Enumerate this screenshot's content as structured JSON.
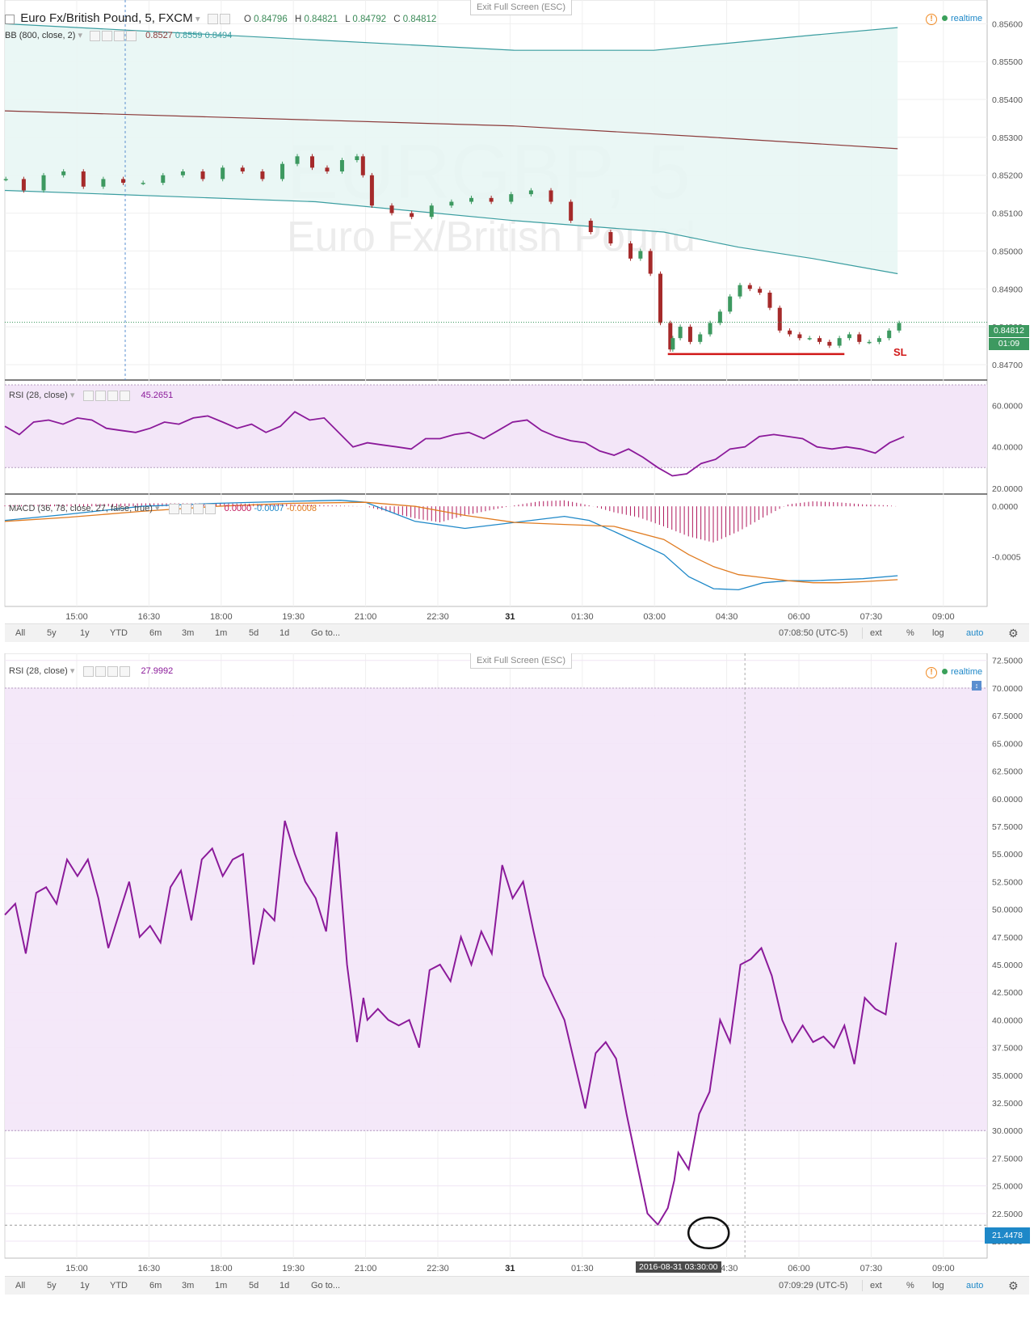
{
  "top": {
    "exit_label": "Exit Full Screen (ESC)",
    "symbol_title": "Euro Fx/British Pound, 5, FXCM",
    "ohlc": {
      "o_label": "O",
      "o": "0.84796",
      "h_label": "H",
      "h": "0.84821",
      "l_label": "L",
      "l": "0.84792",
      "c_label": "C",
      "c": "0.84812"
    },
    "bb_label": "BB (800, close, 2)",
    "bb_values": [
      "0.8527",
      "0.8559",
      "0.8494"
    ],
    "realtime_label": "realtime",
    "watermark_main": "EURGBP, 5",
    "watermark_sub": "Euro Fx/British Pound",
    "last_price": "0.84812",
    "countdown": "01:09",
    "sl_label": "SL",
    "rsi_label": "RSI (28, close)",
    "rsi_value": "45.2651",
    "macd_label": "MACD (36, 78, close, 27, false, true)",
    "macd_values": [
      "0.0000",
      "-0.0007",
      "-0.0008"
    ],
    "time_display": "07:08:50 (UTC-5)"
  },
  "bottom": {
    "exit_label": "Exit Full Screen (ESC)",
    "rsi_label": "RSI (28, close)",
    "rsi_value": "27.9992",
    "realtime_label": "realtime",
    "last_rsi": "21.4478",
    "cursor_date": "2016-08-31 03:30:00",
    "time_display": "07:09:29 (UTC-5)"
  },
  "toolbar": {
    "ranges": [
      "All",
      "5y",
      "1y",
      "YTD",
      "6m",
      "3m",
      "1m",
      "5d",
      "1d"
    ],
    "goto": "Go to...",
    "ext": "ext",
    "percent": "%",
    "log": "log",
    "auto": "auto"
  },
  "x_ticks": [
    "15:00",
    "16:30",
    "18:00",
    "19:30",
    "21:00",
    "22:30",
    "31",
    "01:30",
    "03:00",
    "04:30",
    "06:00",
    "07:30",
    "09:00"
  ],
  "colors": {
    "candle_up": "#3d9960",
    "candle_down": "#a52a2a",
    "bb_band": "#3a9da0",
    "bb_basis": "#8b3a3a",
    "rsi_line": "#8b1a9a",
    "rsi_band": "#f3e6f8",
    "macd_line": "#1e88c8",
    "signal_line": "#e07b20",
    "histogram": "#b0185c",
    "sl_line": "#d01818",
    "last_price_bg": "#3d9960",
    "rsi_tag_bg": "#1e88c8"
  },
  "chart_data": [
    {
      "type": "candlestick",
      "title": "Euro Fx/British Pound, 5, FXCM",
      "y_ticks": [
        "0.85600",
        "0.85500",
        "0.85400",
        "0.85300",
        "0.85200",
        "0.85100",
        "0.85000",
        "0.84900",
        "0.84800",
        "0.84700"
      ],
      "ylim": [
        0.8467,
        0.8562
      ],
      "x_ticks": [
        "15:00",
        "16:30",
        "18:00",
        "19:30",
        "21:00",
        "22:30",
        "31",
        "01:30",
        "03:00",
        "04:30",
        "06:00",
        "07:30",
        "09:00"
      ],
      "x_span_hours": [
        13.75,
        33.5
      ],
      "series": [
        {
          "name": "Close",
          "x": [
            13.77,
            14.13,
            14.53,
            14.93,
            15.33,
            15.73,
            16.13,
            16.53,
            16.93,
            17.33,
            17.73,
            18.13,
            18.53,
            18.93,
            19.33,
            19.63,
            19.93,
            20.23,
            20.53,
            20.83,
            20.95,
            21.13,
            21.53,
            21.93,
            22.33,
            22.73,
            23.13,
            23.53,
            23.93,
            24.33,
            24.73,
            25.13,
            25.53,
            25.93,
            26.33,
            26.53,
            26.73,
            26.93,
            27.13,
            27.18,
            27.33,
            27.53,
            27.73,
            27.93,
            28.13,
            28.33,
            28.53,
            28.73,
            28.93,
            29.13,
            29.33,
            29.53,
            29.73,
            29.93,
            30.13,
            30.33,
            30.53,
            30.73,
            30.93,
            31.13,
            31.33,
            31.53,
            31.73
          ],
          "values": [
            0.8519,
            0.8516,
            0.852,
            0.8521,
            0.8517,
            0.8519,
            0.8518,
            0.8518,
            0.852,
            0.8521,
            0.8519,
            0.8522,
            0.8521,
            0.8519,
            0.8523,
            0.8525,
            0.8522,
            0.8521,
            0.8524,
            0.8525,
            0.852,
            0.8512,
            0.851,
            0.8509,
            0.8512,
            0.8513,
            0.8514,
            0.8513,
            0.8515,
            0.8516,
            0.8513,
            0.8508,
            0.8505,
            0.8502,
            0.8498,
            0.85,
            0.8494,
            0.8481,
            0.8474,
            0.8477,
            0.848,
            0.8476,
            0.8478,
            0.8481,
            0.8484,
            0.8488,
            0.8491,
            0.849,
            0.8489,
            0.8485,
            0.8479,
            0.8478,
            0.8477,
            0.8477,
            0.8476,
            0.8475,
            0.8477,
            0.8478,
            0.8476,
            0.8476,
            0.8477,
            0.8479,
            0.8481
          ]
        },
        {
          "name": "BB Upper",
          "x": [
            13.75,
            24.0,
            26.8,
            30.0,
            31.7
          ],
          "values": [
            0.856,
            0.8553,
            0.8553,
            0.8557,
            0.8559
          ]
        },
        {
          "name": "BB Basis",
          "x": [
            13.75,
            24.0,
            28.0,
            31.7
          ],
          "values": [
            0.8537,
            0.8533,
            0.853,
            0.8527
          ]
        },
        {
          "name": "BB Lower",
          "x": [
            13.75,
            20.0,
            24.0,
            27.0,
            28.5,
            30.0,
            31.7
          ],
          "values": [
            0.8516,
            0.8513,
            0.8508,
            0.8505,
            0.8501,
            0.8498,
            0.8494
          ]
        }
      ],
      "annotations": [
        {
          "text": "SL",
          "y": 0.84728,
          "x_range": [
            27.08,
            30.63
          ]
        }
      ]
    },
    {
      "type": "line",
      "title": "RSI (28, close)",
      "y_ticks": [
        "60.0000",
        "40.0000",
        "20.0000"
      ],
      "ylim": [
        18,
        70
      ],
      "band": [
        30,
        70
      ],
      "series": [
        {
          "name": "RSI (28, close)",
          "x": [
            13.75,
            14.04,
            14.33,
            14.63,
            14.92,
            15.21,
            15.5,
            15.79,
            16.08,
            16.38,
            16.67,
            16.96,
            17.25,
            17.54,
            17.83,
            18.13,
            18.42,
            18.71,
            19.0,
            19.29,
            19.58,
            19.88,
            20.17,
            20.46,
            20.75,
            21.04,
            21.33,
            21.63,
            21.92,
            22.21,
            22.5,
            22.79,
            23.08,
            23.38,
            23.67,
            23.96,
            24.25,
            24.54,
            24.83,
            25.13,
            25.42,
            25.71,
            26.0,
            26.29,
            26.58,
            26.88,
            27.17,
            27.46,
            27.75,
            28.04,
            28.33,
            28.63,
            28.92,
            29.21,
            29.5,
            29.79,
            30.08,
            30.38,
            30.67,
            30.96,
            31.25,
            31.54,
            31.83
          ],
          "values": [
            50,
            46,
            52,
            53,
            51,
            54,
            53,
            49,
            48,
            47,
            49,
            52,
            51,
            54,
            55,
            52,
            49,
            51,
            47,
            50,
            57,
            53,
            54,
            47,
            40,
            42,
            41,
            40,
            39,
            44,
            44,
            46,
            47,
            44,
            48,
            52,
            53,
            48,
            45,
            43,
            42,
            38,
            36,
            39,
            35,
            30,
            26,
            27,
            32,
            34,
            39,
            40,
            45,
            46,
            45,
            44,
            40,
            39,
            40,
            39,
            37,
            42,
            45
          ]
        }
      ]
    },
    {
      "type": "bar",
      "title": "MACD (36, 78, close, 27, false, true)",
      "y_ticks": [
        "0.0000",
        "-0.0005"
      ],
      "ylim": [
        -0.00098,
        9e-05
      ],
      "series": [
        {
          "name": "Histogram",
          "x": [
            13.75,
            15.0,
            16.5,
            18.0,
            19.5,
            21.0,
            22.0,
            22.5,
            23.0,
            23.5,
            24.0,
            24.5,
            25.0,
            25.5,
            26.0,
            26.5,
            27.0,
            27.5,
            28.0,
            28.5,
            29.0,
            29.5,
            30.0,
            30.5,
            31.0,
            31.5,
            31.7
          ],
          "values": [
            1e-05,
            2e-05,
            3e-05,
            3e-05,
            2e-05,
            0.0,
            -0.00012,
            -0.00016,
            -9e-05,
            -4e-05,
            1e-05,
            5e-05,
            6e-05,
            1e-05,
            -6e-05,
            -0.00011,
            -0.0002,
            -0.0003,
            -0.00036,
            -0.00025,
            -0.00011,
            2e-05,
            5e-05,
            4e-05,
            2e-05,
            1e-05,
            0.0
          ]
        },
        {
          "name": "MACD",
          "x": [
            13.75,
            15.0,
            16.5,
            18.0,
            19.5,
            20.5,
            21.0,
            22.0,
            23.0,
            24.0,
            25.0,
            25.5,
            26.0,
            27.0,
            27.5,
            28.0,
            28.5,
            29.0,
            29.5,
            30.0,
            30.5,
            31.0,
            31.7
          ],
          "values": [
            -0.00014,
            -8e-05,
            0.0,
            3e-05,
            5e-05,
            6e-05,
            4e-05,
            -0.00015,
            -0.00022,
            -0.00016,
            -0.0001,
            -0.00014,
            -0.00025,
            -0.00048,
            -0.0007,
            -0.00082,
            -0.00083,
            -0.00076,
            -0.00074,
            -0.00074,
            -0.00073,
            -0.00072,
            -0.00069
          ]
        },
        {
          "name": "Signal",
          "x": [
            13.75,
            15.0,
            16.5,
            18.0,
            19.5,
            21.0,
            22.0,
            23.0,
            24.0,
            25.0,
            26.0,
            27.0,
            27.5,
            28.0,
            28.5,
            29.0,
            29.5,
            30.0,
            30.5,
            31.0,
            31.7
          ],
          "values": [
            -0.00015,
            -0.00011,
            -5e-05,
            0.0,
            3e-05,
            4e-05,
            0.0,
            -9e-05,
            -0.00016,
            -0.00018,
            -0.0002,
            -0.00033,
            -0.00048,
            -0.0006,
            -0.00068,
            -0.00071,
            -0.00074,
            -0.00076,
            -0.00076,
            -0.00075,
            -0.00073
          ]
        }
      ]
    },
    {
      "type": "line",
      "title": "RSI (28, close)",
      "y_ticks": [
        "72.5000",
        "70.0000",
        "67.5000",
        "65.0000",
        "62.5000",
        "60.0000",
        "57.5000",
        "55.0000",
        "52.5000",
        "50.0000",
        "47.5000",
        "45.0000",
        "42.5000",
        "40.0000",
        "37.5000",
        "35.0000",
        "32.5000",
        "30.0000",
        "27.5000",
        "25.0000",
        "22.5000",
        "20.0000"
      ],
      "ylim": [
        19.2,
        72.7
      ],
      "band": [
        30,
        70
      ],
      "series": [
        {
          "name": "RSI (28, close)",
          "x": [
            13.75,
            13.96,
            14.17,
            14.38,
            14.58,
            14.79,
            15.0,
            15.21,
            15.42,
            15.63,
            15.83,
            16.04,
            16.25,
            16.46,
            16.67,
            16.88,
            17.08,
            17.29,
            17.5,
            17.71,
            17.92,
            18.13,
            18.33,
            18.54,
            18.75,
            18.96,
            19.17,
            19.38,
            19.58,
            19.79,
            20.0,
            20.21,
            20.42,
            20.63,
            20.83,
            20.96,
            21.04,
            21.25,
            21.46,
            21.67,
            21.88,
            22.08,
            22.29,
            22.5,
            22.71,
            22.92,
            23.13,
            23.33,
            23.54,
            23.75,
            23.96,
            24.17,
            24.38,
            24.58,
            24.79,
            25.0,
            25.21,
            25.42,
            25.63,
            25.83,
            26.04,
            26.25,
            26.46,
            26.67,
            26.88,
            27.08,
            27.21,
            27.29,
            27.5,
            27.71,
            27.92,
            28.13,
            28.33,
            28.54,
            28.75,
            28.96,
            29.17,
            29.38,
            29.58,
            29.79,
            30.0,
            30.21,
            30.42,
            30.63,
            30.83,
            31.04,
            31.25,
            31.46,
            31.67
          ],
          "values": [
            49.5,
            50.5,
            46.0,
            51.5,
            52.0,
            50.5,
            54.5,
            53.0,
            54.5,
            51.0,
            46.5,
            49.5,
            52.5,
            47.5,
            48.5,
            47.0,
            52.0,
            53.5,
            49.0,
            54.5,
            55.5,
            53.0,
            54.5,
            55.0,
            45.0,
            50.0,
            49.0,
            58.0,
            55.0,
            52.5,
            51.0,
            48.0,
            57.0,
            45.0,
            38.0,
            42.0,
            40.0,
            41.0,
            40.0,
            39.5,
            40.0,
            37.5,
            44.5,
            45.0,
            43.5,
            47.5,
            45.0,
            48.0,
            46.0,
            54.0,
            51.0,
            52.5,
            48.0,
            44.0,
            42.0,
            40.0,
            36.0,
            32.0,
            37.0,
            38.0,
            36.5,
            31.5,
            27.0,
            22.5,
            21.5,
            23.0,
            25.5,
            28.0,
            26.5,
            31.5,
            33.5,
            40.0,
            38.0,
            45.0,
            45.5,
            46.5,
            44.0,
            40.0,
            38.0,
            39.5,
            38.0,
            38.5,
            37.5,
            39.5,
            36.0,
            42.0,
            41.0,
            40.5,
            47.0
          ]
        }
      ]
    }
  ]
}
